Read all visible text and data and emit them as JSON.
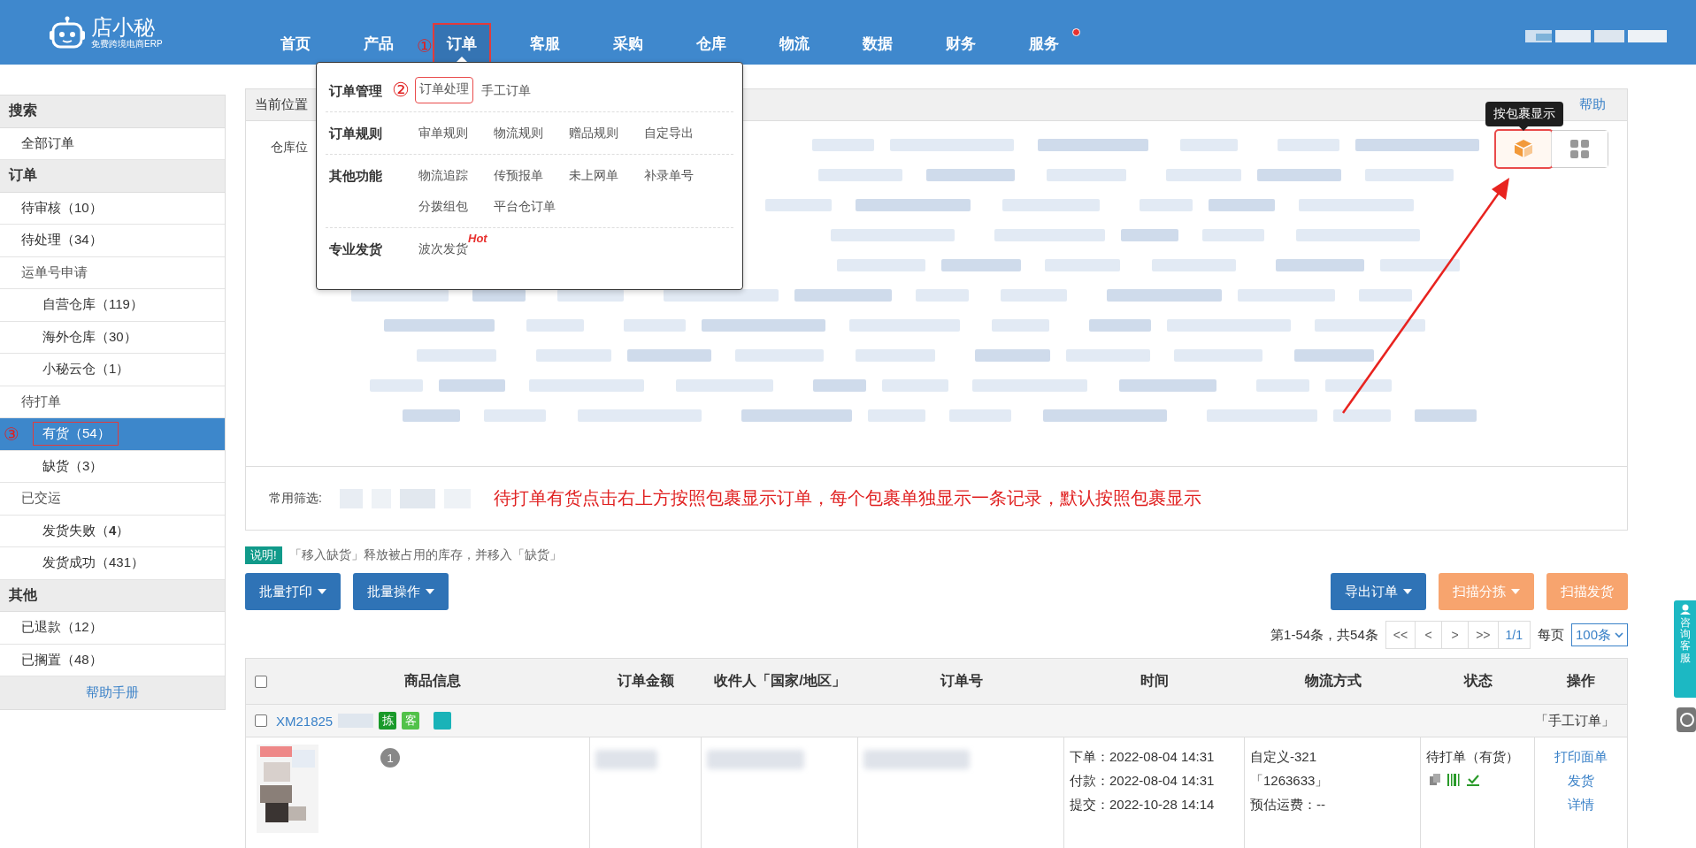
{
  "header": {
    "logo_name": "店小秘",
    "logo_tagline": "免费跨境电商ERP",
    "nav": [
      {
        "label": "首页",
        "selected": false,
        "dot": false
      },
      {
        "label": "产品",
        "selected": false,
        "dot": false
      },
      {
        "label": "订单",
        "selected": true,
        "dot": false,
        "callout": "①",
        "boxed": true
      },
      {
        "label": "客服",
        "selected": false,
        "dot": false
      },
      {
        "label": "采购",
        "selected": false,
        "dot": false
      },
      {
        "label": "仓库",
        "selected": false,
        "dot": false
      },
      {
        "label": "物流",
        "selected": false,
        "dot": false
      },
      {
        "label": "数据",
        "selected": false,
        "dot": false
      },
      {
        "label": "财务",
        "selected": false,
        "dot": false
      },
      {
        "label": "服务",
        "selected": false,
        "dot": true
      }
    ]
  },
  "nav_menu": {
    "groups": [
      {
        "title": "订单管理",
        "callout": "②",
        "items": [
          {
            "label": "订单处理",
            "boxed": true
          },
          {
            "label": "手工订单",
            "boxed": false
          }
        ]
      },
      {
        "title": "订单规则",
        "items": [
          {
            "label": "审单规则",
            "boxed": false
          },
          {
            "label": "物流规则",
            "boxed": false
          },
          {
            "label": "赠品规则",
            "boxed": false
          },
          {
            "label": "自定导出",
            "boxed": false
          }
        ]
      },
      {
        "title": "其他功能",
        "items": [
          {
            "label": "物流追踪",
            "boxed": false
          },
          {
            "label": "传预报单",
            "boxed": false
          },
          {
            "label": "未上网单",
            "boxed": false
          },
          {
            "label": "补录单号",
            "boxed": false
          },
          {
            "label": "分拨组包",
            "boxed": false
          },
          {
            "label": "平台仓订单",
            "boxed": false
          }
        ]
      },
      {
        "title": "专业发货",
        "items": [
          {
            "label": "波次发货",
            "boxed": false,
            "badge": "Hot"
          }
        ]
      }
    ]
  },
  "sidebar": {
    "sections": [
      {
        "title": "搜索",
        "items": [
          {
            "label": "全部订单",
            "selected": false
          }
        ]
      },
      {
        "title": "订单",
        "items": [
          {
            "label": "待审核（10）",
            "selected": false
          },
          {
            "label": "待处理（34）",
            "selected": false
          },
          {
            "label": "运单号申请",
            "selected": false,
            "children": [
              {
                "label": "自营仓库（119）",
                "selected": false
              },
              {
                "label": "海外仓库（30）",
                "selected": false
              },
              {
                "label": "小秘云仓（1）",
                "selected": false
              }
            ]
          },
          {
            "label": "待打单",
            "selected": false,
            "children": [
              {
                "label": "有货（54）",
                "selected": true,
                "callout": "③",
                "boxed": true
              },
              {
                "label": "缺货（3）",
                "selected": false
              }
            ]
          },
          {
            "label": "已交运",
            "selected": false,
            "children": [
              {
                "label": "发货失败（**4**）",
                "selected": false
              },
              {
                "label": "发货成功（431）",
                "selected": false
              }
            ]
          }
        ]
      },
      {
        "title": "其他",
        "items": [
          {
            "label": "已退款（12）",
            "selected": false
          },
          {
            "label": "已搁置（48）",
            "selected": false
          }
        ]
      }
    ],
    "help_link": "帮助手册"
  },
  "filter_panel": {
    "breadcrumb": "当前位置",
    "help_link": "帮助",
    "filter_label": "仓库位",
    "view_toggle": [
      {
        "kind": "package",
        "selected": true,
        "boxed": true,
        "tooltip": "按包裹显示"
      },
      {
        "kind": "grid",
        "selected": false,
        "boxed": false
      }
    ],
    "common_filter_label": "常用筛选:"
  },
  "annotation": {
    "text": "待打单有货点击右上方按照包裹显示订单，每个包裹单独显示一条记录，默认按照包裹显示",
    "arrow": true
  },
  "notice": {
    "badge": "说明!",
    "text": "「移入缺货」释放被占用的库存，并移入「缺货」"
  },
  "toolbar": {
    "left": [
      {
        "label": "批量打印",
        "kind": "primary",
        "dropdown": true
      },
      {
        "label": "批量操作",
        "kind": "primary",
        "dropdown": true
      }
    ],
    "right": [
      {
        "label": "导出订单",
        "kind": "primary",
        "dropdown": true
      },
      {
        "label": "扫描分拣",
        "kind": "warning",
        "dropdown": true
      },
      {
        "label": "扫描发货",
        "kind": "warning",
        "dropdown": false
      }
    ]
  },
  "pagination": {
    "summary": "第1-54条，共54条",
    "buttons": [
      "<<",
      "<",
      ">",
      ">>",
      "1/1"
    ],
    "per_page_label": "每页",
    "per_page": "100条"
  },
  "table": {
    "select_all_checked": false,
    "columns": [
      "商品信息",
      "订单金额",
      "收件人「国家/地区」",
      "订单号",
      "时间",
      "物流方式",
      "状态",
      "操作"
    ],
    "orders": [
      {
        "checked": false,
        "order_no": "XM21825",
        "tags": [
          {
            "label": "拣",
            "color": "#1a9a2a"
          },
          {
            "label": "客",
            "color": "#52c24a"
          },
          {
            "color": "#19b3b8"
          }
        ],
        "source": "「手工订单」",
        "quantity": "1",
        "times": [
          "下单：2022-08-04 14:31",
          "付款：2022-08-04 14:31",
          "提交：2022-10-28 14:14"
        ],
        "logistics": [
          "自定义-321",
          "「1263633」",
          "预估运费：--"
        ],
        "status": "待打单（有货）",
        "actions": [
          "打印面单",
          "发货",
          "详情"
        ]
      }
    ]
  },
  "side_widget": {
    "label": "咨询客服"
  }
}
